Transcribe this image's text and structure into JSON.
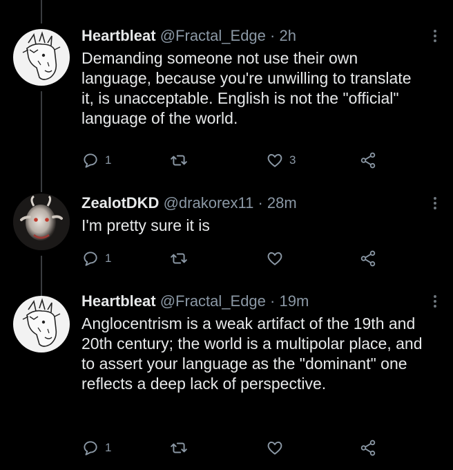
{
  "tweets": [
    {
      "name": "Heartbleat",
      "handle": "@Fractal_Edge",
      "time": "2h",
      "text": "Demanding someone not use their own language, because you're unwilling to translate it, is unacceptable. English is not the \"official\" language of the world.",
      "reply_count": "1",
      "like_count": "3",
      "avatar": "horse-sketch-avatar"
    },
    {
      "name": "ZealotDKD",
      "handle": "@drakorex11",
      "time": "28m",
      "text": "I'm pretty sure it is",
      "reply_count": "1",
      "like_count": "",
      "avatar": "goat-photo-avatar"
    },
    {
      "name": "Heartbleat",
      "handle": "@Fractal_Edge",
      "time": "19m",
      "text": "Anglocentrism is a weak artifact of the 19th and 20th century; the world is a multipolar place, and to assert your language as the \"dominant\" one reflects a deep lack of perspective.",
      "reply_count": "1",
      "like_count": "",
      "avatar": "horse-sketch-avatar"
    }
  ],
  "separator": "·",
  "colors": {
    "background": "#000000",
    "text": "#e7e9ea",
    "secondary": "#8b98a5",
    "thread_line": "#3a3d40"
  }
}
